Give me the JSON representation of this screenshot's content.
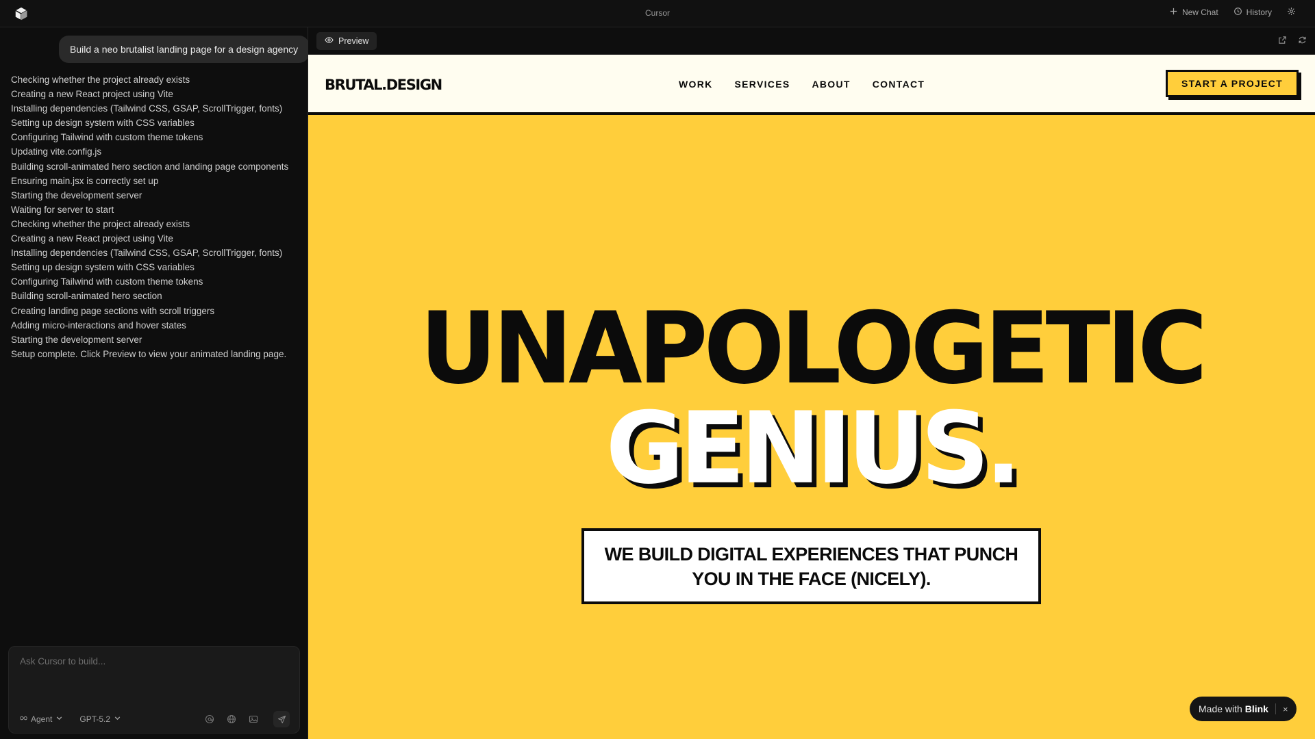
{
  "app": {
    "title": "Cursor"
  },
  "topbar": {
    "new_chat_label": "New Chat",
    "history_label": "History"
  },
  "chat": {
    "user_message": "Build a neo brutalist landing page for a design agency",
    "steps": [
      "Checking whether the project already exists",
      "Creating a new React project using Vite",
      "Installing dependencies (Tailwind CSS, GSAP, ScrollTrigger, fonts)",
      "Setting up design system with CSS variables",
      "Configuring Tailwind with custom theme tokens",
      "Updating vite.config.js",
      "Building scroll-animated hero section and landing page components",
      "Ensuring main.jsx is correctly set up",
      "Starting the development server",
      "Waiting for server to start",
      "Checking whether the project already exists",
      "Creating a new React project using Vite",
      "Installing dependencies (Tailwind CSS, GSAP, ScrollTrigger, fonts)",
      "Setting up design system with CSS variables",
      "Configuring Tailwind with custom theme tokens",
      "Building scroll-animated hero section",
      "Creating landing page sections with scroll triggers",
      "Adding micro-interactions and hover states",
      "Starting the development server",
      "Setup complete. Click Preview to view your animated landing page."
    ],
    "composer": {
      "placeholder": "Ask Cursor to build...",
      "mode_label": "Agent",
      "model_label": "GPT-5.2"
    }
  },
  "preview": {
    "tab_label": "Preview"
  },
  "site": {
    "brand": "BRUTAL.DESIGN",
    "nav": [
      "WORK",
      "SERVICES",
      "ABOUT",
      "CONTACT"
    ],
    "cta": "START A PROJECT",
    "hero_line1": "UNAPOLOGETIC",
    "hero_line2": "GENIUS.",
    "tagline_line1": "WE BUILD DIGITAL EXPERIENCES THAT PUNCH",
    "tagline_line2": "YOU IN THE FACE (NICELY).",
    "colors": {
      "accent": "#FFCE3B",
      "ink": "#0b0b0b",
      "paper": "#FFFDF0"
    }
  },
  "badge": {
    "prefix": "Made with",
    "brand": "Blink",
    "close": "×"
  }
}
